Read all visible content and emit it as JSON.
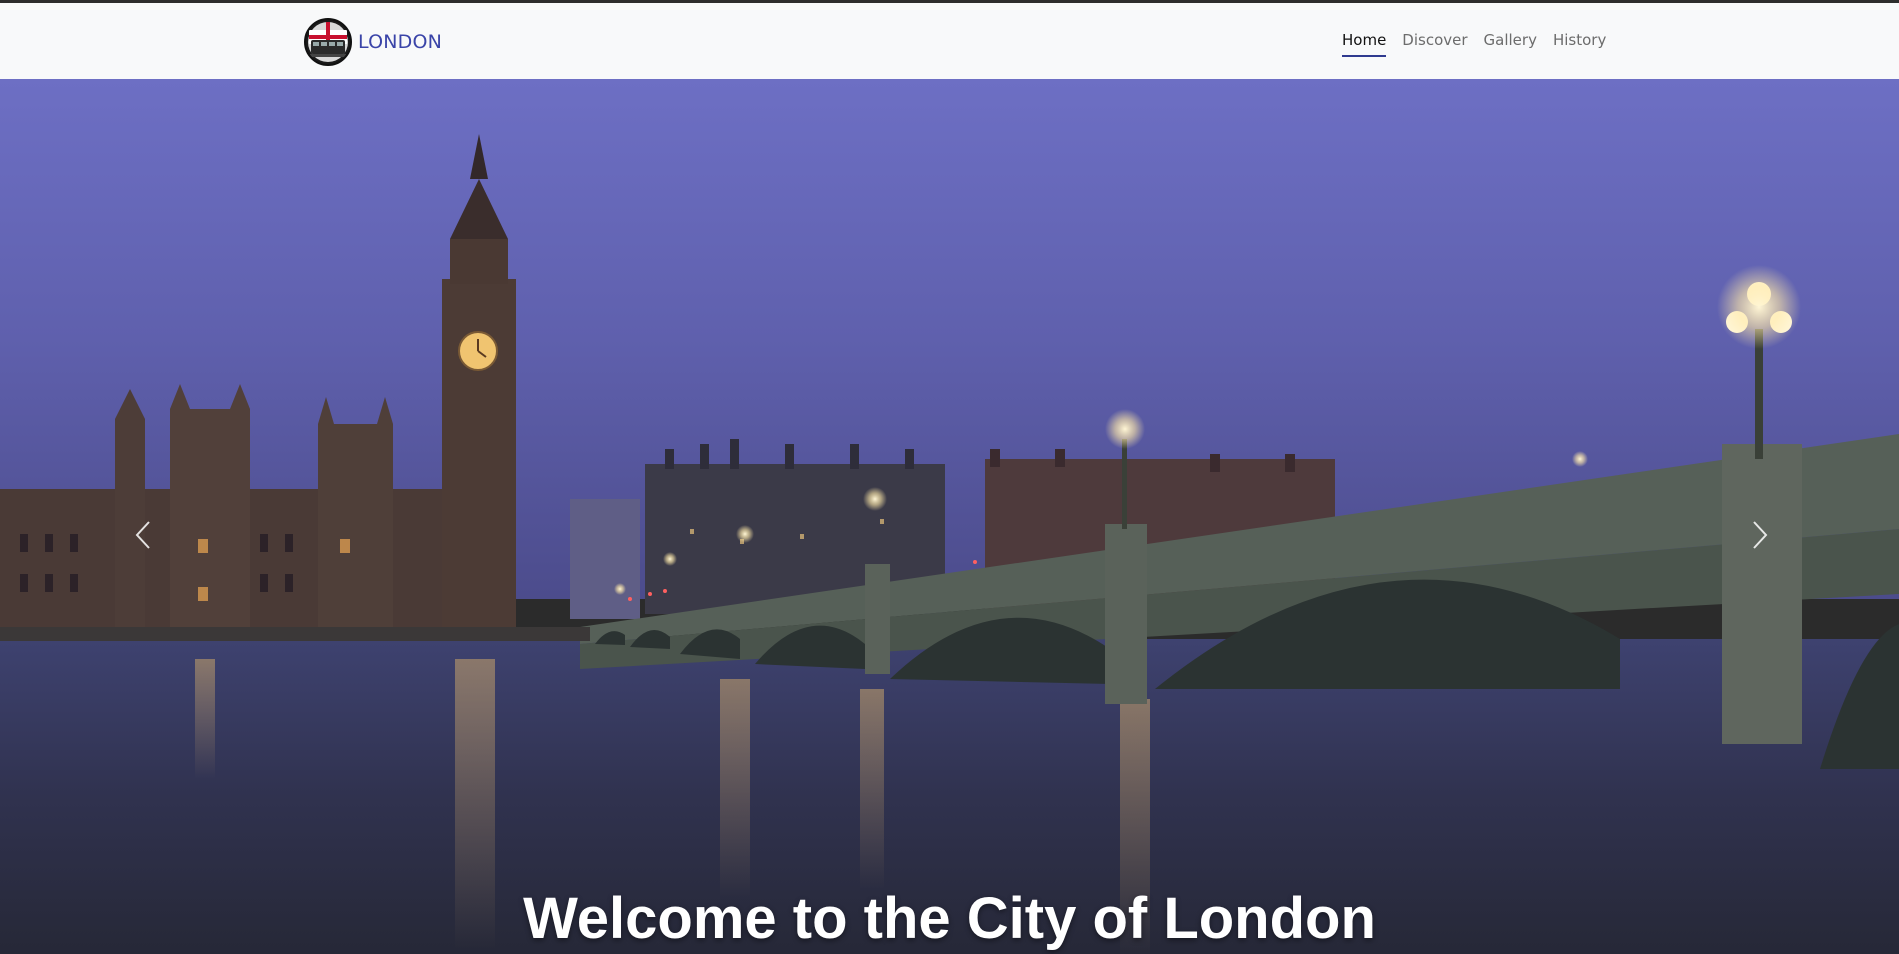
{
  "navbar": {
    "brand": {
      "logo_icon": "london-bus-logo-icon",
      "text": "LONDON"
    },
    "links": [
      {
        "label": "Home",
        "active": true
      },
      {
        "label": "Discover",
        "active": false
      },
      {
        "label": "Gallery",
        "active": false
      },
      {
        "label": "History",
        "active": false
      }
    ]
  },
  "hero": {
    "image": "thames-westminster-bridge-big-ben-dusk",
    "prev_icon": "chevron-left-icon",
    "next_icon": "chevron-right-icon",
    "caption": "Welcome to the City of London"
  },
  "colors": {
    "brand": "#3a44a8",
    "nav_bg": "#f8f9fa",
    "active_underline": "#2f3a8f",
    "sky": "#6c6cc8"
  }
}
